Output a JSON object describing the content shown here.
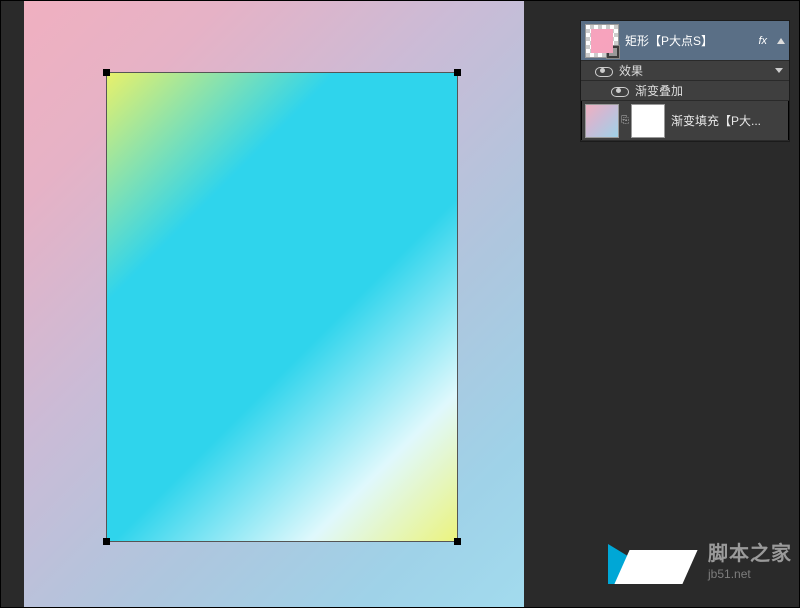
{
  "layers": {
    "shape_layer": {
      "name": "矩形【P大点S】",
      "fx_badge": "fx"
    },
    "effects_header": "效果",
    "effect_gradient_overlay": "渐变叠加",
    "fill_layer": {
      "name": "渐变填充【P大..."
    }
  },
  "watermark": {
    "site_cn": "脚本之家",
    "site_en": "jb51.net"
  }
}
